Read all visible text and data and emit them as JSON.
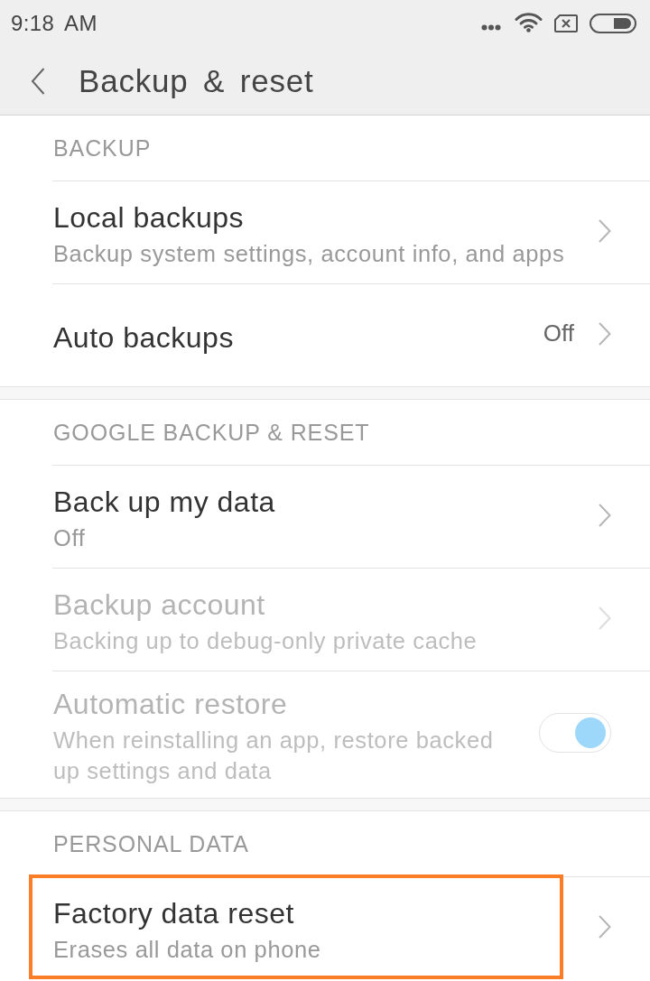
{
  "status_bar": {
    "time": "9:18 AM"
  },
  "toolbar": {
    "title": "Backup & reset"
  },
  "sections": [
    {
      "header": "BACKUP",
      "items": [
        {
          "kind": "link",
          "title": "Local backups",
          "subtitle": "Backup system settings, account info, and apps",
          "disabled": false,
          "highlighted": false
        },
        {
          "kind": "link",
          "title": "Auto backups",
          "value": "Off",
          "disabled": false,
          "highlighted": false
        }
      ]
    },
    {
      "header": "GOOGLE BACKUP & RESET",
      "items": [
        {
          "kind": "link",
          "title": "Back up my data",
          "subtitle": "Off",
          "disabled": false,
          "highlighted": false
        },
        {
          "kind": "link",
          "title": "Backup account",
          "subtitle": "Backing up to debug-only private cache",
          "disabled": true,
          "highlighted": false
        },
        {
          "kind": "toggle",
          "title": "Automatic restore",
          "subtitle": "When reinstalling an app, restore backed up settings and data",
          "on": true,
          "disabled": true,
          "highlighted": false
        }
      ]
    },
    {
      "header": "PERSONAL DATA",
      "items": [
        {
          "kind": "link",
          "title": "Factory data reset",
          "subtitle": "Erases all data on phone",
          "disabled": false,
          "highlighted": true
        }
      ]
    }
  ]
}
